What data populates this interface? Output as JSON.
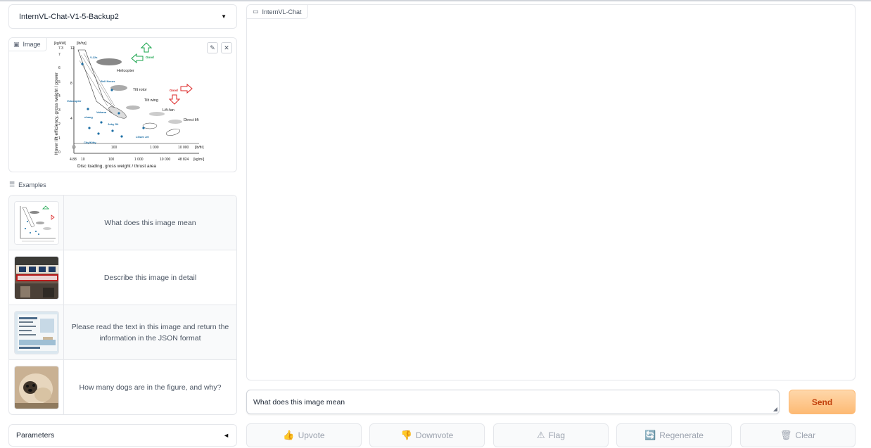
{
  "model_selector": {
    "value": "InternVL-Chat-V1-5-Backup2"
  },
  "image_panel": {
    "label": "Image",
    "chart": {
      "y_unit_left": "[kg/kW]",
      "y_unit_right": "[lb/hp]",
      "y_axis_label": "Hover lift efficiency, gross weight / power",
      "x_axis_label": "Disc loading, gross weight / thrust area",
      "x_unit_top": "[lb/ft²]",
      "x_unit_bottom": "[kg/m²]",
      "x_ticks_top": [
        "10",
        "100",
        "1 000",
        "10 000"
      ],
      "x_ticks_bottom": [
        "4.88",
        "10",
        "100",
        "1 000",
        "10 000",
        "48 824"
      ],
      "y_ticks_left": [
        "7.3",
        "7",
        "6",
        "5",
        "4",
        "3",
        "2",
        "1",
        "0"
      ],
      "y_ticks_right": [
        "12",
        "8",
        "4"
      ],
      "labels": {
        "helicopter": "Helicopter",
        "tilt_rotor": "Tilt rotor",
        "tilt_wing": "Tilt wing",
        "lift_fan": "Lift-fan",
        "direct_lift": "Direct lift",
        "good_top": "Good",
        "good_right": "Good",
        "v22": "V-22s",
        "bell_nexus": "Bell Nexus",
        "volocopter": "Volocopter",
        "ehang": "ehang",
        "vahana": "Vahana",
        "joby": "Joby S4",
        "kittyhawk": "City/Kitty",
        "lilium": "Lilium Jet"
      }
    }
  },
  "examples": {
    "label": "Examples",
    "rows": [
      {
        "prompt": "What does this image mean"
      },
      {
        "prompt": "Describe this image in detail"
      },
      {
        "prompt": "Please read the text in this image and return the information in the JSON format"
      },
      {
        "prompt": "How many dogs are in the figure, and why?"
      }
    ]
  },
  "parameters": {
    "label": "Parameters"
  },
  "chatbot": {
    "label": "InternVL-Chat"
  },
  "input": {
    "value": "What does this image mean"
  },
  "send_label": "Send",
  "actions": {
    "upvote": "Upvote",
    "downvote": "Downvote",
    "flag": "Flag",
    "regenerate": "Regenerate",
    "clear": "Clear"
  },
  "colors": {
    "send_bg": "#fdba74",
    "send_text": "#c2410c",
    "good_green": "#16a34a",
    "good_red": "#dc2626",
    "marker_blue": "#1d6fa5"
  }
}
